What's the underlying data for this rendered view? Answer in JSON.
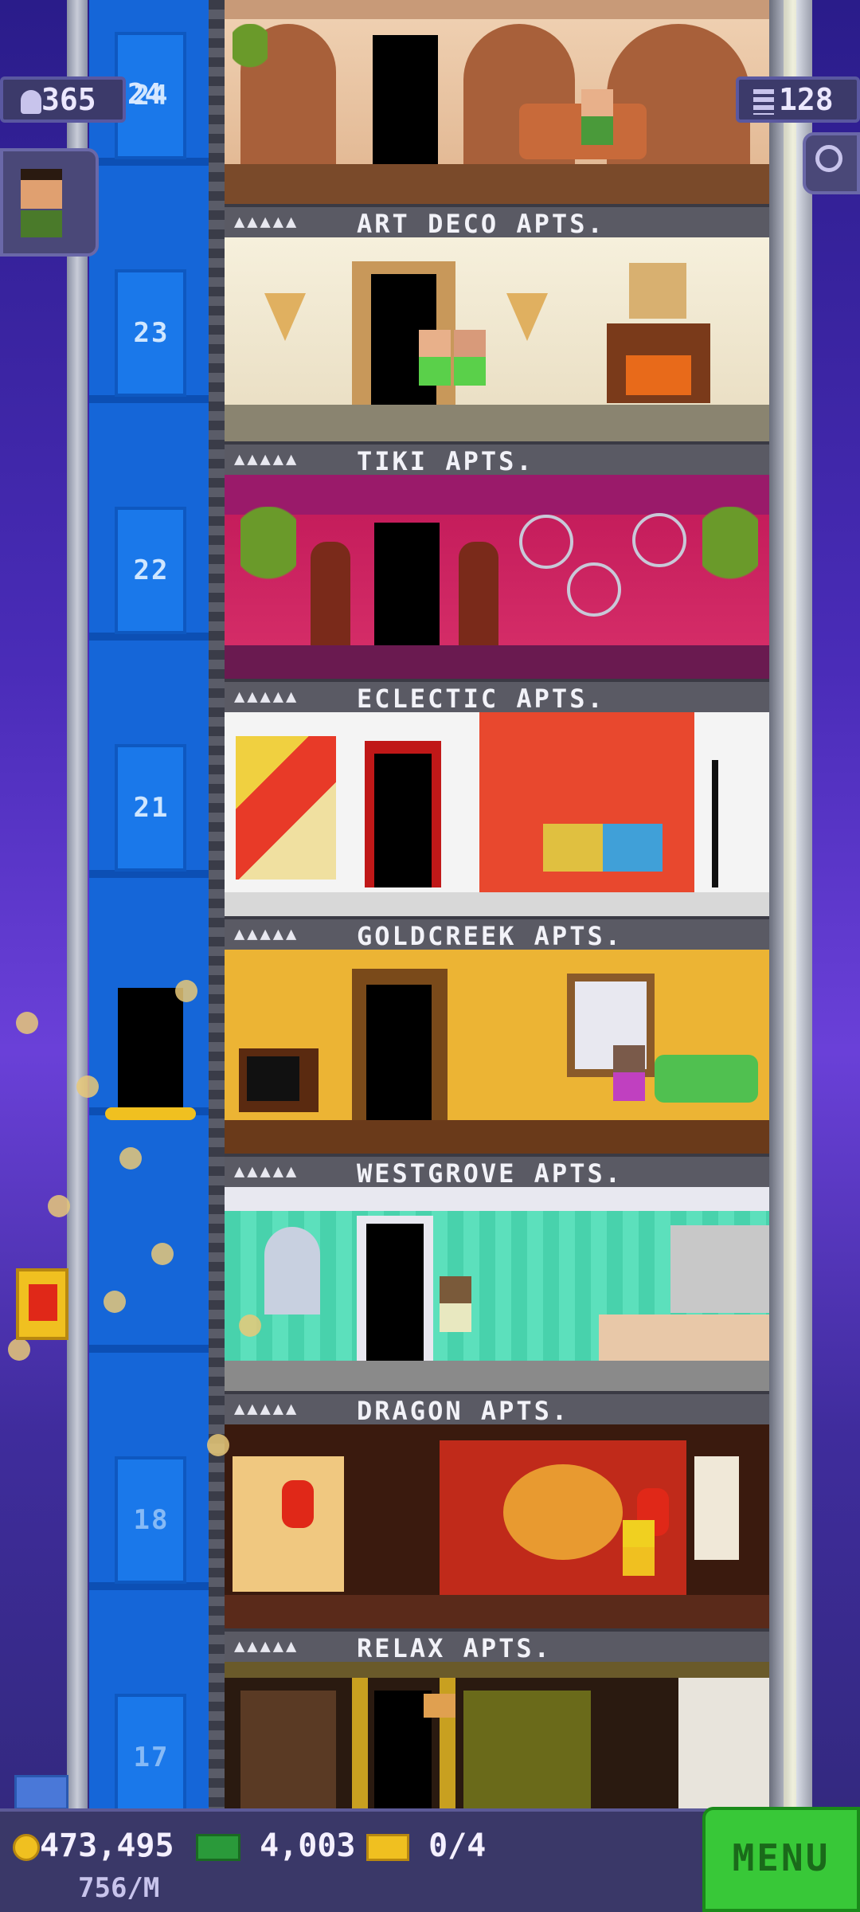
{
  "header": {
    "population": "365",
    "population_icon": "person-icon",
    "current_floor": "24",
    "floors_count": "128",
    "floors_icon": "building-icon",
    "search_icon": "magnifier-icon"
  },
  "elevator": {
    "floor_labels": [
      "24",
      "23",
      "22",
      "21",
      "18",
      "17"
    ]
  },
  "floors": [
    {
      "name": "ART DECO APTS.",
      "people": "▲▲▲▲▲",
      "wall": "#e9c7a6"
    },
    {
      "name": "TIKI APTS.",
      "people": "▲▲▲▲▲",
      "wall": "#efe6cf"
    },
    {
      "name": "ECLECTIC APTS.",
      "people": "▲▲▲▲▲",
      "wall": "#c8205a"
    },
    {
      "name": "GOLDCREEK APTS.",
      "people": "▲▲▲▲▲",
      "wall": "#e84a30"
    },
    {
      "name": "WESTGROVE APTS.",
      "people": "▲▲▲▲▲",
      "wall": "#e8b030"
    },
    {
      "name": "DRAGON APTS.",
      "people": "▲▲▲▲▲",
      "wall": "#4cd6b0"
    },
    {
      "name": "RELAX APTS.",
      "people": "▲▲▲▲▲",
      "wall": "#3a1a10"
    }
  ],
  "currency": {
    "coins": "473,495",
    "rate": "756/M",
    "bux": "4,003",
    "tickets": "0/4"
  },
  "menu_label": "MENU"
}
